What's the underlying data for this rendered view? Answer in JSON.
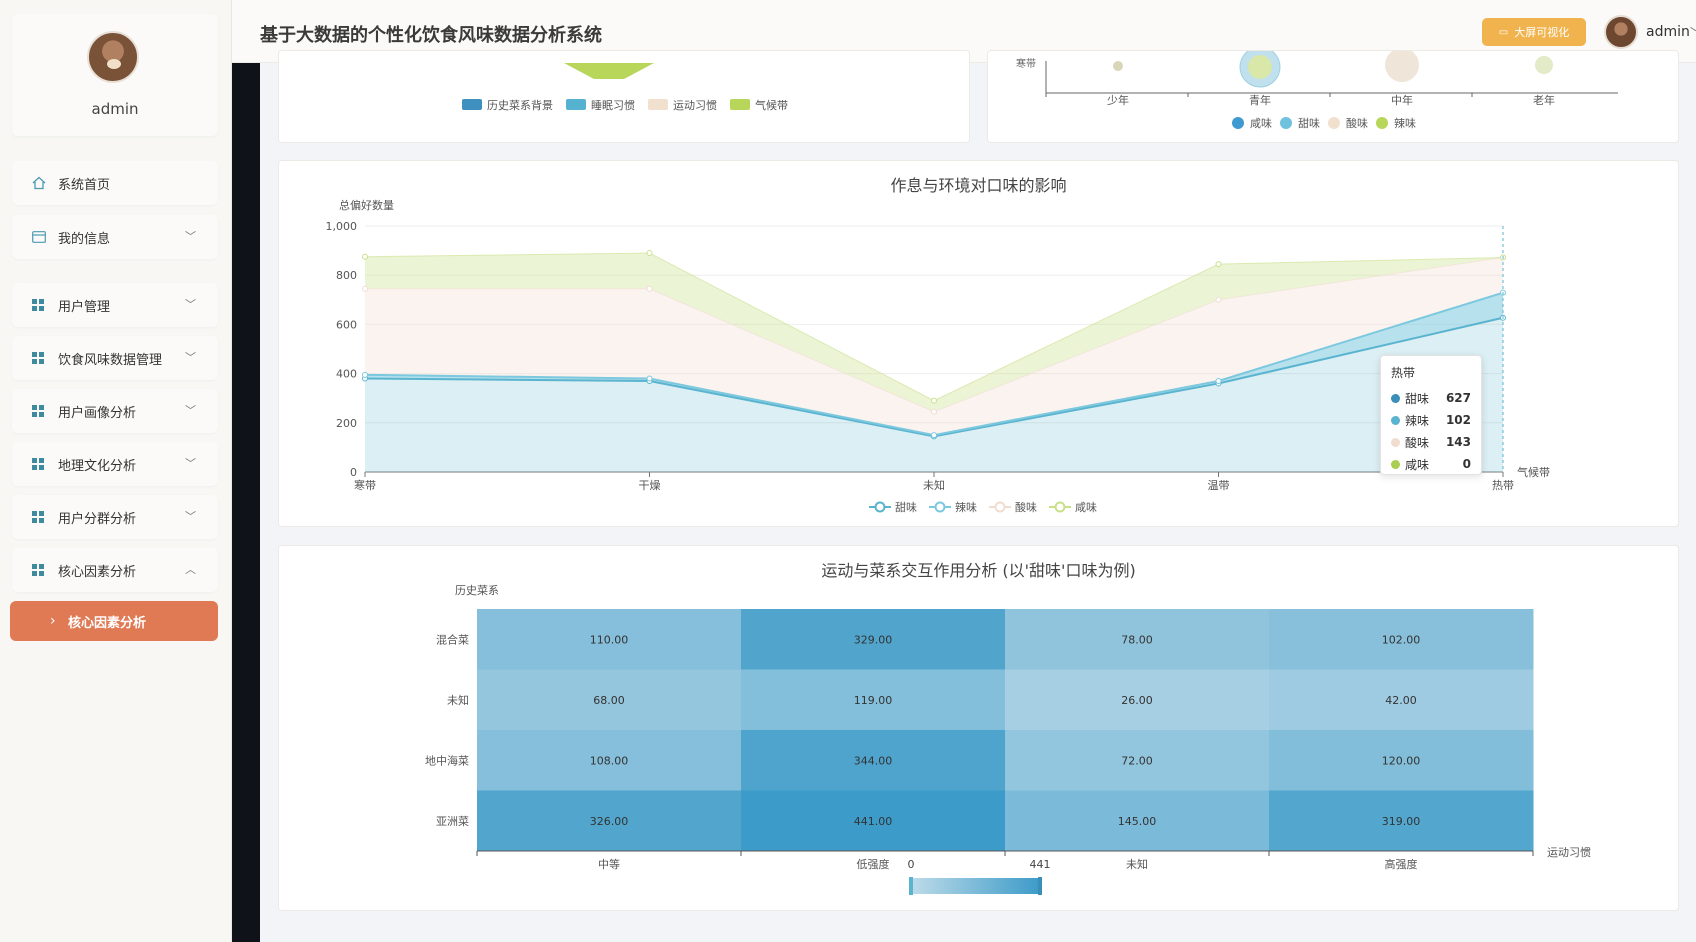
{
  "header": {
    "title": "基于大数据的个性化饮食风味数据分析系统",
    "screen_button": "大屏可视化",
    "username": "admin"
  },
  "sidebar": {
    "username": "admin",
    "items": [
      {
        "label": "系统首页",
        "icon": "home-icon"
      },
      {
        "label": "我的信息",
        "icon": "card-icon",
        "chevron": "down"
      },
      {
        "label": "用户管理",
        "icon": "grid-icon",
        "chevron": "down"
      },
      {
        "label": "饮食风味数据管理",
        "icon": "grid-icon",
        "chevron": "down"
      },
      {
        "label": "用户画像分析",
        "icon": "grid-icon",
        "chevron": "down"
      },
      {
        "label": "地理文化分析",
        "icon": "grid-icon",
        "chevron": "down"
      },
      {
        "label": "用户分群分析",
        "icon": "grid-icon",
        "chevron": "down"
      },
      {
        "label": "核心因素分析",
        "icon": "grid-icon",
        "chevron": "up"
      }
    ],
    "active_sub": "核心因素分析",
    "active_color": "#e07a55"
  },
  "top_left_panel": {
    "legend": [
      {
        "name": "历史菜系背景",
        "color": "#3f8fbf"
      },
      {
        "name": "睡眠习惯",
        "color": "#55b2d0"
      },
      {
        "name": "运动习惯",
        "color": "#f2e0cf"
      },
      {
        "name": "气候带",
        "color": "#b7d65a"
      }
    ]
  },
  "top_right_panel": {
    "y_label_partial": "寒带",
    "x_ticks": [
      "少年",
      "青年",
      "中年",
      "老年"
    ],
    "legend": [
      {
        "name": "咸味",
        "color": "#3f9bcf"
      },
      {
        "name": "甜味",
        "color": "#6fc1dd"
      },
      {
        "name": "酸味",
        "color": "#f2e0cf"
      },
      {
        "name": "辣味",
        "color": "#b7d65a"
      }
    ]
  },
  "chart_data": [
    {
      "type": "area",
      "title": "作息与环境对口味的影响",
      "ylabel": "总偏好数量",
      "xlabel": "气候带",
      "categories": [
        "寒带",
        "干燥",
        "未知",
        "温带",
        "热带"
      ],
      "ylim": [
        0,
        1000
      ],
      "yticks": [
        "0",
        "200",
        "400",
        "600",
        "800",
        "1,000"
      ],
      "stacked": true,
      "series": [
        {
          "name": "甜味",
          "color": "#5ab4cf",
          "values": [
            380,
            370,
            145,
            360,
            627
          ]
        },
        {
          "name": "辣味",
          "color": "#7cc8de",
          "values": [
            15,
            10,
            5,
            10,
            102
          ]
        },
        {
          "name": "酸味",
          "color": "#f0ddd0",
          "values": [
            350,
            365,
            95,
            330,
            143
          ]
        },
        {
          "name": "咸味",
          "color": "#c9e08a",
          "values": [
            130,
            145,
            45,
            145,
            0
          ]
        }
      ],
      "tooltip": {
        "category": "热带",
        "rows": [
          {
            "name": "甜味",
            "value": "627",
            "color": "#3a8fb8"
          },
          {
            "name": "辣味",
            "value": "102",
            "color": "#5ab4cf"
          },
          {
            "name": "酸味",
            "value": "143",
            "color": "#f0ddd0"
          },
          {
            "name": "咸味",
            "value": "0",
            "color": "#a9cf52"
          }
        ]
      }
    },
    {
      "type": "heatmap",
      "title": "运动与菜系交互作用分析 (以'甜味'口味为例)",
      "ylabel": "历史菜系",
      "xlabel": "运动习惯",
      "x_categories": [
        "中等",
        "低强度",
        "未知",
        "高强度"
      ],
      "y_categories": [
        "混合菜",
        "未知",
        "地中海菜",
        "亚洲菜"
      ],
      "values": [
        [
          110.0,
          329.0,
          78.0,
          102.0
        ],
        [
          68.0,
          119.0,
          26.0,
          42.0
        ],
        [
          108.0,
          344.0,
          72.0,
          120.0
        ],
        [
          326.0,
          441.0,
          145.0,
          319.0
        ]
      ],
      "visual_map": {
        "min": "0",
        "max": "441"
      }
    }
  ]
}
